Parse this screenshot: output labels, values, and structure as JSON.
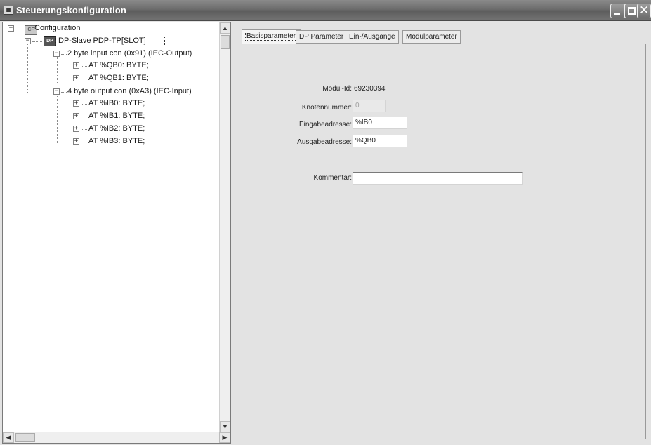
{
  "window": {
    "title": "Steuerungskonfiguration",
    "app_icon": "plc-config-icon"
  },
  "tree": {
    "root": "Configuration",
    "slave": "DP-Slave PDP-TP[SLOT]",
    "group1": "2  byte input con  (0x91) (IEC-Output)",
    "group1_items": [
      "AT %QB0: BYTE;",
      "AT %QB1: BYTE;"
    ],
    "group2": "4  byte output con (0xA3) (IEC-Input)",
    "group2_items": [
      "AT %IB0: BYTE;",
      "AT %IB1: BYTE;",
      "AT %IB2: BYTE;",
      "AT %IB3: BYTE;"
    ]
  },
  "tabs": [
    "Basisparameter",
    "DP Parameter",
    "Ein-/Ausgänge",
    "Modulparameter"
  ],
  "basis": {
    "modul_id_label": "Modul-Id:",
    "modul_id_value": "69230394",
    "knotennummer_label": "Knotennummer:",
    "knotennummer_value": "0",
    "eingabe_label": "Eingabeadresse:",
    "eingabe_value": "%IB0",
    "ausgabe_label": "Ausgabeadresse:",
    "ausgabe_value": "%QB0",
    "kommentar_label": "Kommentar:",
    "kommentar_value": ""
  },
  "colors": {
    "titlebar": "#6c6c6c",
    "panel": "#e3e3e3"
  }
}
